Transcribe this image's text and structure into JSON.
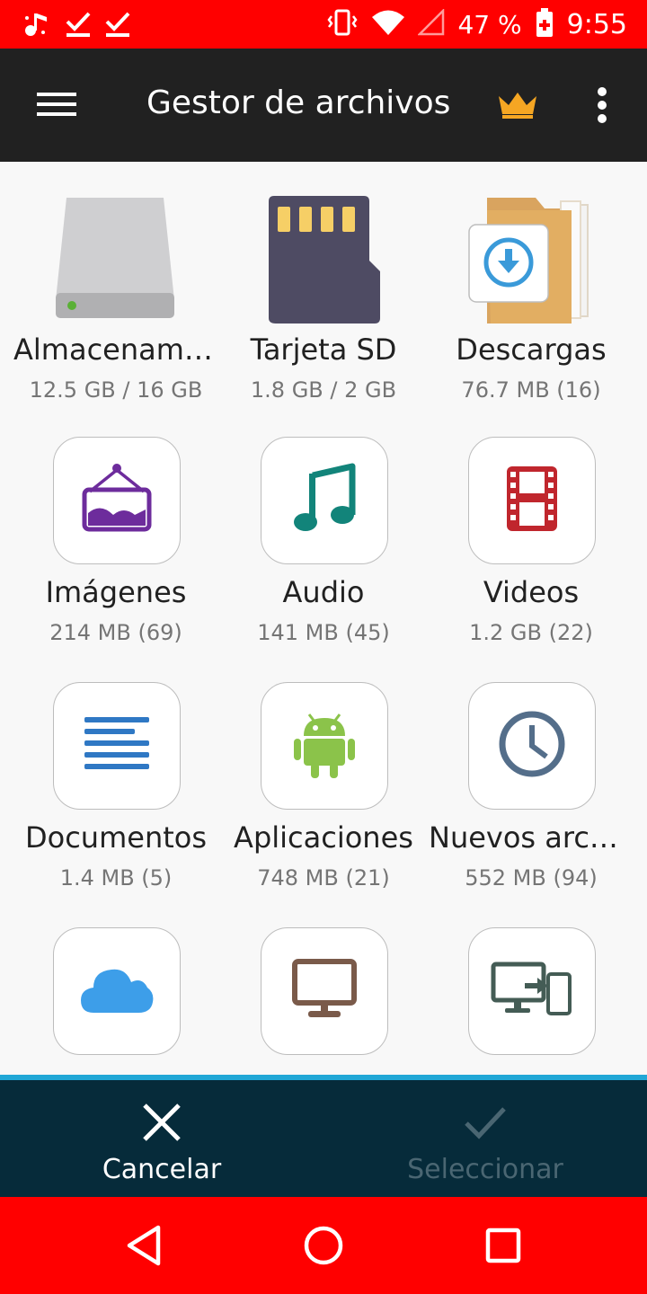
{
  "status_bar": {
    "battery": "47 %",
    "time": "9:55",
    "left_icons": [
      "music-notification-icon",
      "checkmark-notification-icon",
      "checkmark-notification-icon"
    ],
    "right_icons": [
      "vibrate-icon",
      "wifi-icon",
      "signal-icon",
      "battery-icon"
    ]
  },
  "app_bar": {
    "title": "Gestor de archivos",
    "menu_icon": "hamburger-menu-icon",
    "premium_icon": "crown-icon",
    "overflow_icon": "more-vertical-icon"
  },
  "tiles": [
    {
      "name": "Almacenamiento",
      "info": "12.5 GB / 16 GB",
      "icon": "internal-storage-icon"
    },
    {
      "name": "Tarjeta SD",
      "info": "1.8 GB / 2 GB",
      "icon": "sd-card-icon"
    },
    {
      "name": "Descargas",
      "info": "76.7 MB (16)",
      "icon": "downloads-folder-icon"
    },
    {
      "name": "Imágenes",
      "info": "214 MB (69)",
      "icon": "image-frame-icon"
    },
    {
      "name": "Audio",
      "info": "141 MB (45)",
      "icon": "music-note-icon"
    },
    {
      "name": "Videos",
      "info": "1.2 GB (22)",
      "icon": "film-strip-icon"
    },
    {
      "name": "Documentos",
      "info": "1.4 MB (5)",
      "icon": "document-lines-icon"
    },
    {
      "name": "Aplicaciones",
      "info": "748 MB (21)",
      "icon": "android-icon"
    },
    {
      "name": "Nuevos archivos",
      "info": "552 MB (94)",
      "icon": "clock-icon"
    },
    {
      "name": "",
      "info": "",
      "icon": "cloud-icon"
    },
    {
      "name": "",
      "info": "",
      "icon": "monitor-icon"
    },
    {
      "name": "",
      "info": "",
      "icon": "device-transfer-icon"
    }
  ],
  "actions": {
    "cancel_label": "Cancelar",
    "select_label": "Seleccionar"
  },
  "colors": {
    "status_bar": "#ff0000",
    "app_bar": "#212121",
    "action_bar": "#062b3a",
    "accent": "#21a7d6"
  }
}
